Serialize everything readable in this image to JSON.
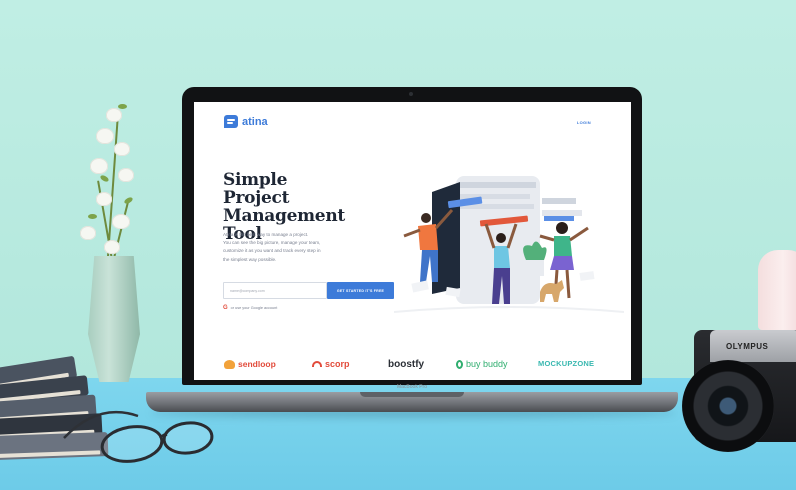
{
  "laptop": {
    "model": "MacBook Pro"
  },
  "page": {
    "nav": {
      "logo_text": "atina",
      "login_label": "LOGIN"
    },
    "hero": {
      "title_lines": [
        "Simple",
        "Project Management",
        "Tool"
      ],
      "description_lines": [
        "Atina is the best way to manage a project.",
        "You can see the big picture, manage your team,",
        "customize it as you want and track every step in",
        "the simplest way possible."
      ],
      "email_placeholder": "name@company.com",
      "cta_label": "GET STARTED IT'S FREE",
      "google_label": "or use your Google account",
      "google_icon": "google-g-icon",
      "accent": "#3d7bd9"
    },
    "brands": [
      {
        "name": "sendloop",
        "color": "#e24b3b",
        "icon": "sendloop-icon"
      },
      {
        "name": "scorp",
        "color": "#e24b3b",
        "icon": "scorp-icon"
      },
      {
        "name": "boostfy",
        "color": "#2b2f36",
        "icon": ""
      },
      {
        "name": "buy buddy",
        "color": "#2fae6f",
        "icon": "buddy-icon"
      },
      {
        "name": "MOCKUPZONE",
        "color": "#39b8b0",
        "icon": ""
      }
    ]
  },
  "camera": {
    "brand": "OLYMPUS"
  }
}
